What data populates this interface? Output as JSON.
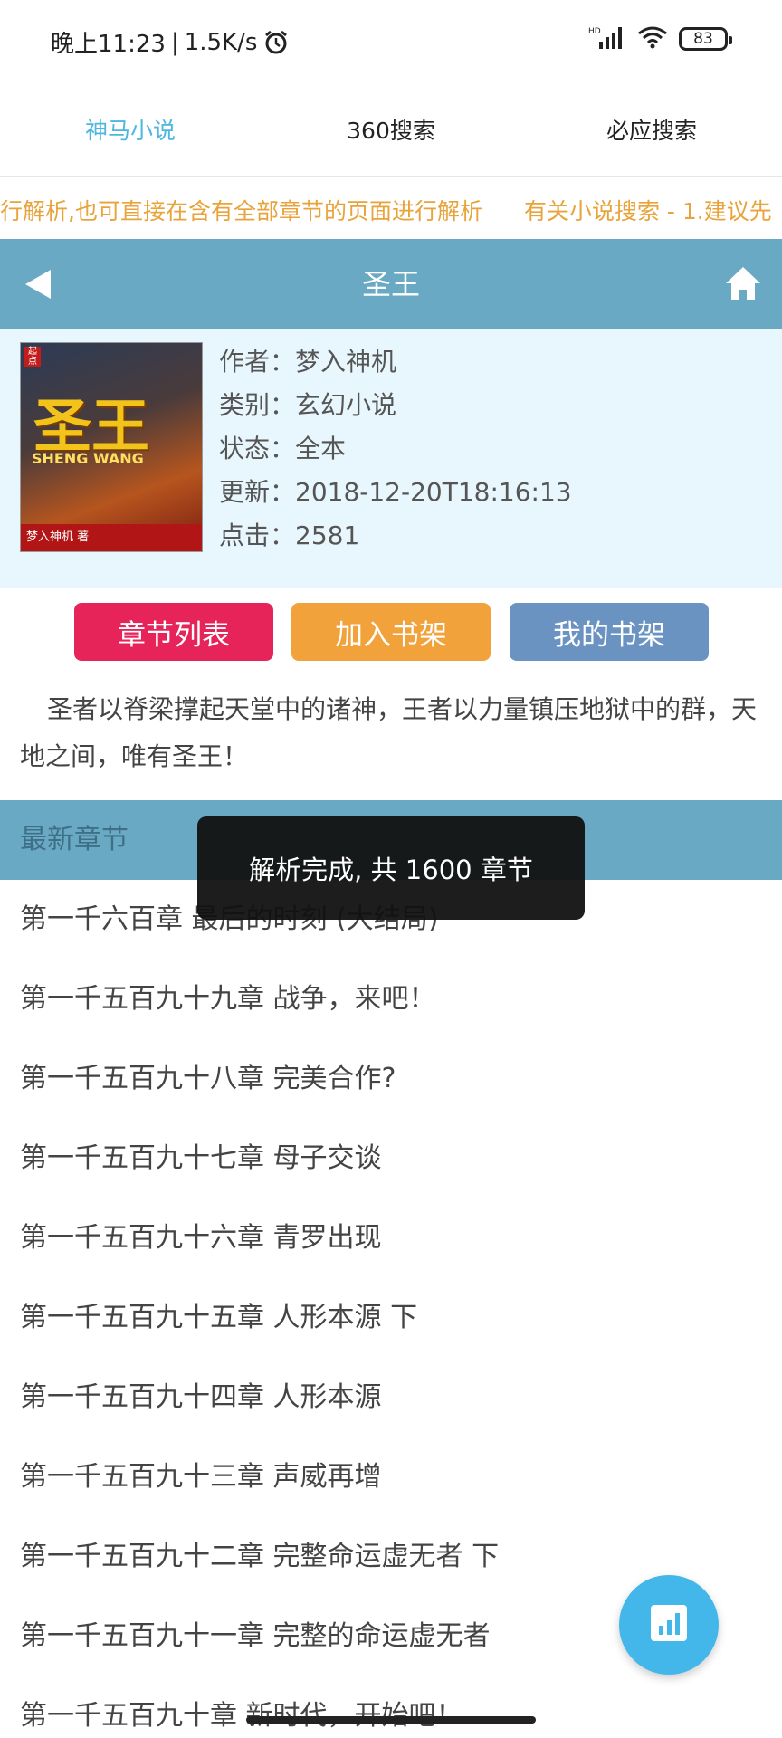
{
  "status_bar": {
    "time": "晚上11:23",
    "speed": "1.5K/s",
    "network_label": "HD",
    "battery": "83"
  },
  "engines": {
    "items": [
      {
        "label": "神马小说"
      },
      {
        "label": "360搜索"
      },
      {
        "label": "必应搜索"
      }
    ]
  },
  "notice": {
    "text1": "行解析,也可直接在含有全部章节的页面进行解析",
    "text2": "有关小说搜索 - 1.建议先"
  },
  "header": {
    "title": "圣王"
  },
  "book": {
    "cover_title": "圣王",
    "cover_subtitle": "SHENG WANG",
    "cover_author_text": "梦入神机 著",
    "meta": {
      "author": "作者：梦入神机",
      "category": "类别：玄幻小说",
      "status": "状态：全本",
      "updated": "更新：2018-12-20T18:16:13",
      "clicks": "点击：2581"
    }
  },
  "actions": {
    "chapters": "章节列表",
    "add_shelf": "加入书架",
    "my_shelf": "我的书架"
  },
  "description": "圣者以脊梁撑起天堂中的诸神，王者以力量镇压地狱中的群，天地之间，唯有圣王！",
  "latest": {
    "header": "最新章节",
    "chapters": [
      "第一千六百章 最后的时刻 (大结局)",
      "第一千五百九十九章 战争，来吧！",
      "第一千五百九十八章 完美合作?",
      "第一千五百九十七章 母子交谈",
      "第一千五百九十六章 青罗出现",
      "第一千五百九十五章 人形本源 下",
      "第一千五百九十四章 人形本源",
      "第一千五百九十三章 声威再增",
      "第一千五百九十二章 完整命运虚无者 下",
      "第一千五百九十一章 完整的命运虚无者",
      "第一千五百九十章 新时代，开始吧！"
    ]
  },
  "toast": {
    "message": "解析完成, 共 1600 章节"
  },
  "icons": {
    "back": "back-arrow-icon",
    "home": "home-icon",
    "fab": "stats-icon",
    "alarm": "alarm-icon",
    "signal": "signal-icon",
    "wifi": "wifi-icon"
  },
  "colors": {
    "accent": "#4db6e1",
    "title_bar": "#6aa9c3",
    "notice": "#e8a33a",
    "btn_chapters": "#e6245a",
    "btn_add": "#f2a23a",
    "btn_shelf": "#6a93c2",
    "info_bg": "#e8f7fd"
  }
}
